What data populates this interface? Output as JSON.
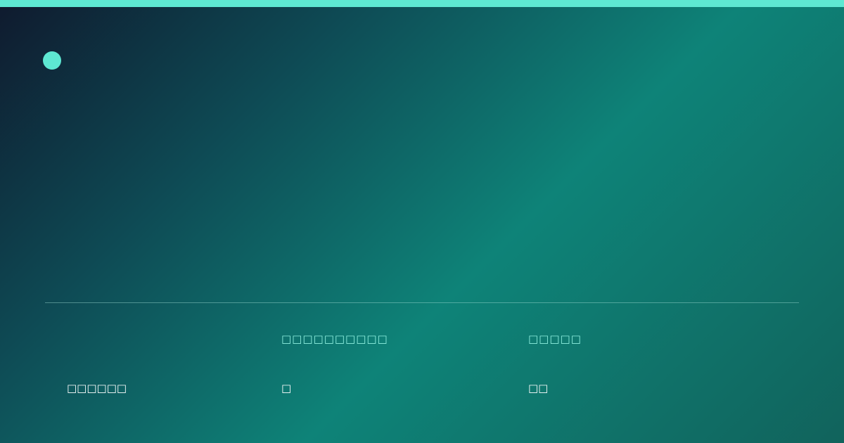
{
  "card": {
    "accent_color": "#5ee8d2",
    "background_colors": [
      "#0f1a2e",
      "#0e4b55",
      "#0e8378",
      "#11635c"
    ],
    "brand_icon": "circle-dot-icon"
  },
  "stats": {
    "row_label": "□□□□□□",
    "columns": [
      {
        "label": "□□□□□□□□□□",
        "value": "□"
      },
      {
        "label": "□□□□□",
        "value": "□□"
      }
    ]
  }
}
